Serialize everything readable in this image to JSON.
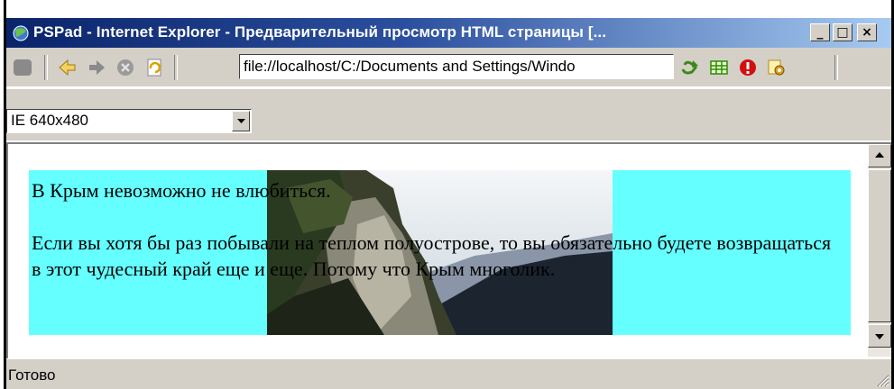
{
  "window": {
    "title": "PSPad - Internet Explorer - Предварительный просмотр HTML страницы  [...",
    "buttons": {
      "minimize": "_",
      "maximize": "□",
      "close": "×"
    }
  },
  "toolbar": {
    "address": "file://localhost/C:/Documents and Settings/Windo",
    "icons": [
      "stop-gray-icon",
      "back-arrow-icon",
      "forward-arrow-icon",
      "stop-icon",
      "refresh-icon",
      "go-icon",
      "table-icon",
      "alert-icon",
      "settings-icon"
    ]
  },
  "size_select": {
    "value": "IE 640x480"
  },
  "page": {
    "paragraph1": "В Крым невозможно не влюбиться.",
    "paragraph2": "Если вы хотя бы раз побывали на теплом полуострове, то вы обязательно будете возвращаться в этот чудесный край еще и еще. Потому что Крым многолик.",
    "background": "#66ffff"
  },
  "status": {
    "text": "Готово"
  }
}
